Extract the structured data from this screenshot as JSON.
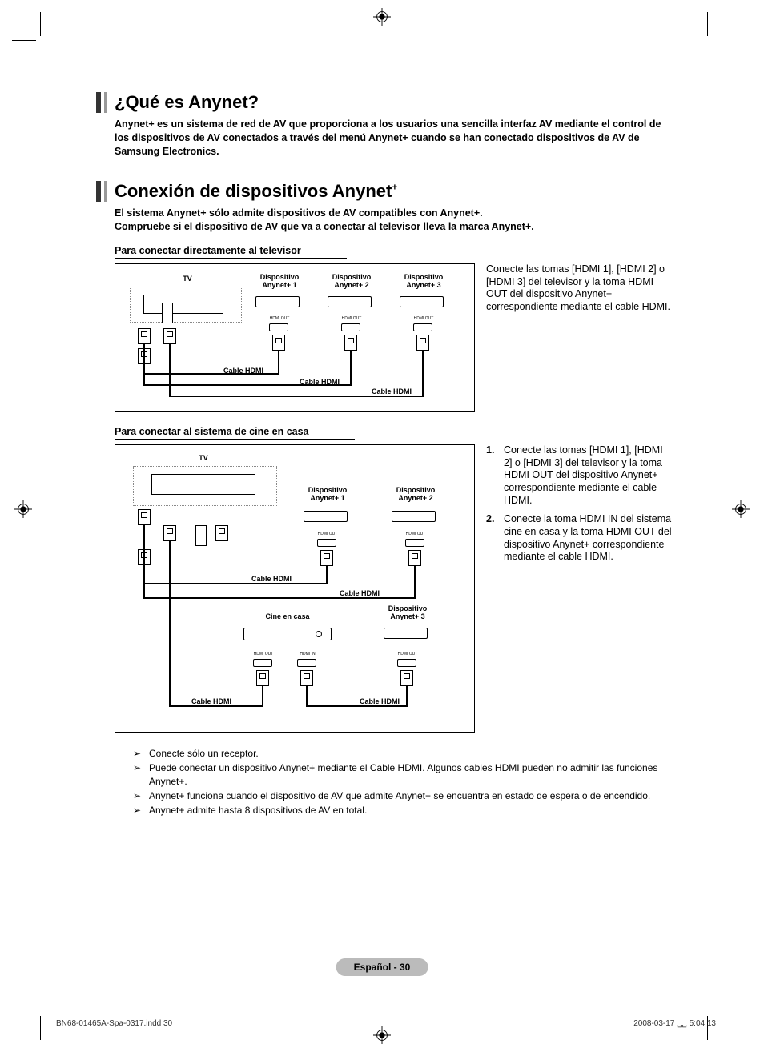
{
  "section1": {
    "heading": "¿Qué es Anynet?",
    "intro": "Anynet+ es un sistema de red de AV que proporciona a los usuarios una sencilla interfaz AV mediante el control de los dispositivos de AV conectados a través del menú Anynet+ cuando se han conectado dispositivos de AV de Samsung Electronics."
  },
  "section2": {
    "heading_pre": "Conexión de dispositivos Anynet",
    "heading_sup": "+",
    "intro": "El sistema Anynet+ sólo admite dispositivos de AV compatibles con Anynet+.\nCompruebe si el dispositivo de AV que va a conectar al televisor lleva la marca Anynet+.",
    "sub1": "Para conectar directamente al televisor",
    "sub2": "Para conectar al sistema de cine en casa",
    "side1": "Conecte las tomas [HDMI 1], [HDMI 2] o [HDMI 3] del televisor y la toma HDMI OUT del dispositivo Anynet+ correspondiente mediante el cable HDMI.",
    "side2": {
      "item1_num": "1.",
      "item1": "Conecte las tomas [HDMI 1], [HDMI 2] o [HDMI 3] del televisor y la toma HDMI OUT del dispositivo Anynet+ correspondiente mediante el cable HDMI.",
      "item2_num": "2.",
      "item2": "Conecte la toma HDMI IN del sistema cine en casa y la toma HDMI OUT del dispositivo Anynet+ correspondiente mediante el cable HDMI."
    }
  },
  "diagram1": {
    "tv": "TV",
    "dev1": "Dispositivo\nAnynet+ 1",
    "dev2": "Dispositivo\nAnynet+ 2",
    "dev3": "Dispositivo\nAnynet+ 3",
    "hdmi_out": "HDMI OUT",
    "cable": "Cable HDMI"
  },
  "diagram2": {
    "tv": "TV",
    "dev1": "Dispositivo\nAnynet+ 1",
    "dev2": "Dispositivo\nAnynet+ 2",
    "dev3": "Dispositivo\nAnynet+ 3",
    "home": "Cine en casa",
    "hdmi_out": "HDMI OUT",
    "hdmi_in": "HDMI IN",
    "cable": "Cable HDMI"
  },
  "notes": {
    "n1": "Conecte sólo un receptor.",
    "n2": "Puede conectar un dispositivo Anynet+ mediante el Cable HDMI. Algunos cables HDMI pueden no admitir las funciones Anynet+.",
    "n3": "Anynet+ funciona cuando el dispositivo de AV que admite Anynet+ se encuentra en estado de espera o de encendido.",
    "n4": "Anynet+ admite hasta 8 dispositivos de AV en total."
  },
  "page_badge": "Español - 30",
  "footer": {
    "left": "BN68-01465A-Spa-0317.indd   30",
    "right": "2008-03-17   ␣␣ 5:04:13"
  }
}
